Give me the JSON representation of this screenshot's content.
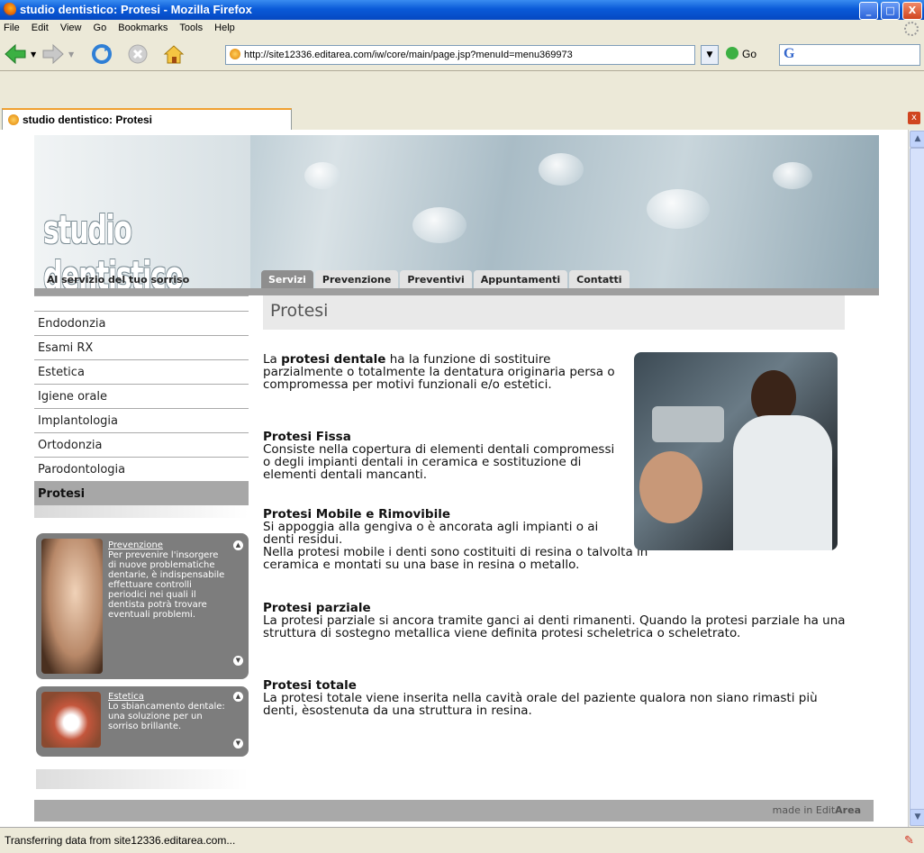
{
  "window": {
    "title": "studio dentistico: Protesi - Mozilla Firefox",
    "buttons": {
      "minimize": "_",
      "maximize": "□",
      "close": "X"
    }
  },
  "menubar": [
    "File",
    "Edit",
    "View",
    "Go",
    "Bookmarks",
    "Tools",
    "Help"
  ],
  "navbar": {
    "url": "http://site12336.editarea.com/iw/core/main/page.jsp?menuId=menu369973",
    "go_label": "Go",
    "search_icon": "G"
  },
  "tab": {
    "label": "studio dentistico: Protesi",
    "close": "x"
  },
  "site": {
    "logo": "studio dentistico",
    "tagline": "Al servizio del tuo sorriso",
    "nav": [
      {
        "label": "Servizi",
        "active": true
      },
      {
        "label": "Prevenzione",
        "active": false
      },
      {
        "label": "Preventivi",
        "active": false
      },
      {
        "label": "Appuntamenti",
        "active": false
      },
      {
        "label": "Contatti",
        "active": false
      }
    ],
    "sidebar": [
      {
        "label": "Endodonzia",
        "active": false
      },
      {
        "label": "Esami RX",
        "active": false
      },
      {
        "label": "Estetica",
        "active": false
      },
      {
        "label": "Igiene orale",
        "active": false
      },
      {
        "label": "Implantologia",
        "active": false
      },
      {
        "label": "Ortodonzia",
        "active": false
      },
      {
        "label": "Parodontologia",
        "active": false
      },
      {
        "label": "Protesi",
        "active": true
      }
    ],
    "promos": [
      {
        "title": "Prevenzione",
        "text": "Per prevenire l'insorgere di nuove problematiche dentarie, è indispensabile effettuare controlli periodici nei quali il dentista potrà trovare eventuali problemi."
      },
      {
        "title": "Estetica",
        "text": "Lo sbiancamento dentale: una soluzione per un sorriso brillante."
      }
    ],
    "page_title": "Protesi",
    "intro": {
      "before": "La ",
      "bold": "protesi dentale",
      "after": " ha la funzione di sostituire parzialmente o totalmente la dentatura originaria persa o compromessa per motivi funzionali e/o estetici."
    },
    "sections": [
      {
        "heading": "Protesi Fissa",
        "body": "Consiste nella copertura di elementi dentali compromessi o degli impianti dentali in ceramica e sostituzione di elementi dentali mancanti."
      },
      {
        "heading": "Protesi Mobile e Rimovibile",
        "body": "Si appoggia alla gengiva o è ancorata agli impianti o ai denti residui.",
        "body2": "Nella protesi mobile i denti sono costituiti di resina o talvolta in ceramica e montati su una base in resina o metallo."
      },
      {
        "heading": "Protesi parziale",
        "body": "La protesi parziale si ancora tramite ganci ai denti rimanenti. Quando la protesi parziale ha una struttura di sostegno metallica viene definita protesi scheletrica o scheletrato."
      },
      {
        "heading": "Protesi totale",
        "body": "La protesi totale viene inserita nella cavità orale del paziente qualora non siano rimasti più denti, èsostenuta da una struttura in resina."
      }
    ],
    "footer": {
      "prefix": "made in Edit",
      "brand": "Area"
    }
  },
  "status": {
    "text": "Transferring data from site12336.editarea.com..."
  },
  "colors": {
    "titlebar": "#0a5ad8",
    "active_tab": "#8e8e8e",
    "footer": "#a9a9a9"
  }
}
